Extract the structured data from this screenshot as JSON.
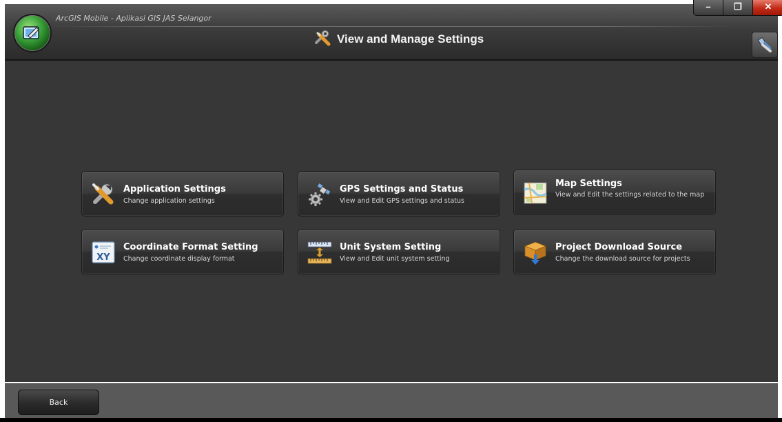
{
  "window": {
    "app_title": "ArcGIS Mobile - Aplikasi GIS JAS Selangor",
    "page_title": "View and Manage Settings",
    "controls": {
      "minimize": "–",
      "maximize": "❐",
      "close": "✕"
    }
  },
  "cards": [
    {
      "title": "Application Settings",
      "description": "Change application settings",
      "icon": "wrench-screwdriver-icon"
    },
    {
      "title": "GPS Settings and Status",
      "description": "View and Edit GPS settings and status",
      "icon": "gps-satellite-gear-icon"
    },
    {
      "title": "Map Settings",
      "description": "View and Edit the settings related to the map",
      "icon": "map-icon"
    },
    {
      "title": "Coordinate Format Setting",
      "description": "Change coordinate display format",
      "icon": "xy-coordinate-icon"
    },
    {
      "title": "Unit System Setting",
      "description": "View and Edit unit system setting",
      "icon": "ruler-units-icon"
    },
    {
      "title": "Project Download Source",
      "description": "Change the download source for projects",
      "icon": "package-download-icon"
    }
  ],
  "footer": {
    "back_label": "Back"
  },
  "colors": {
    "background": "#373737",
    "titlebar": "#3c3c3c",
    "close": "#c02a16",
    "accent": "#3aa13a"
  }
}
